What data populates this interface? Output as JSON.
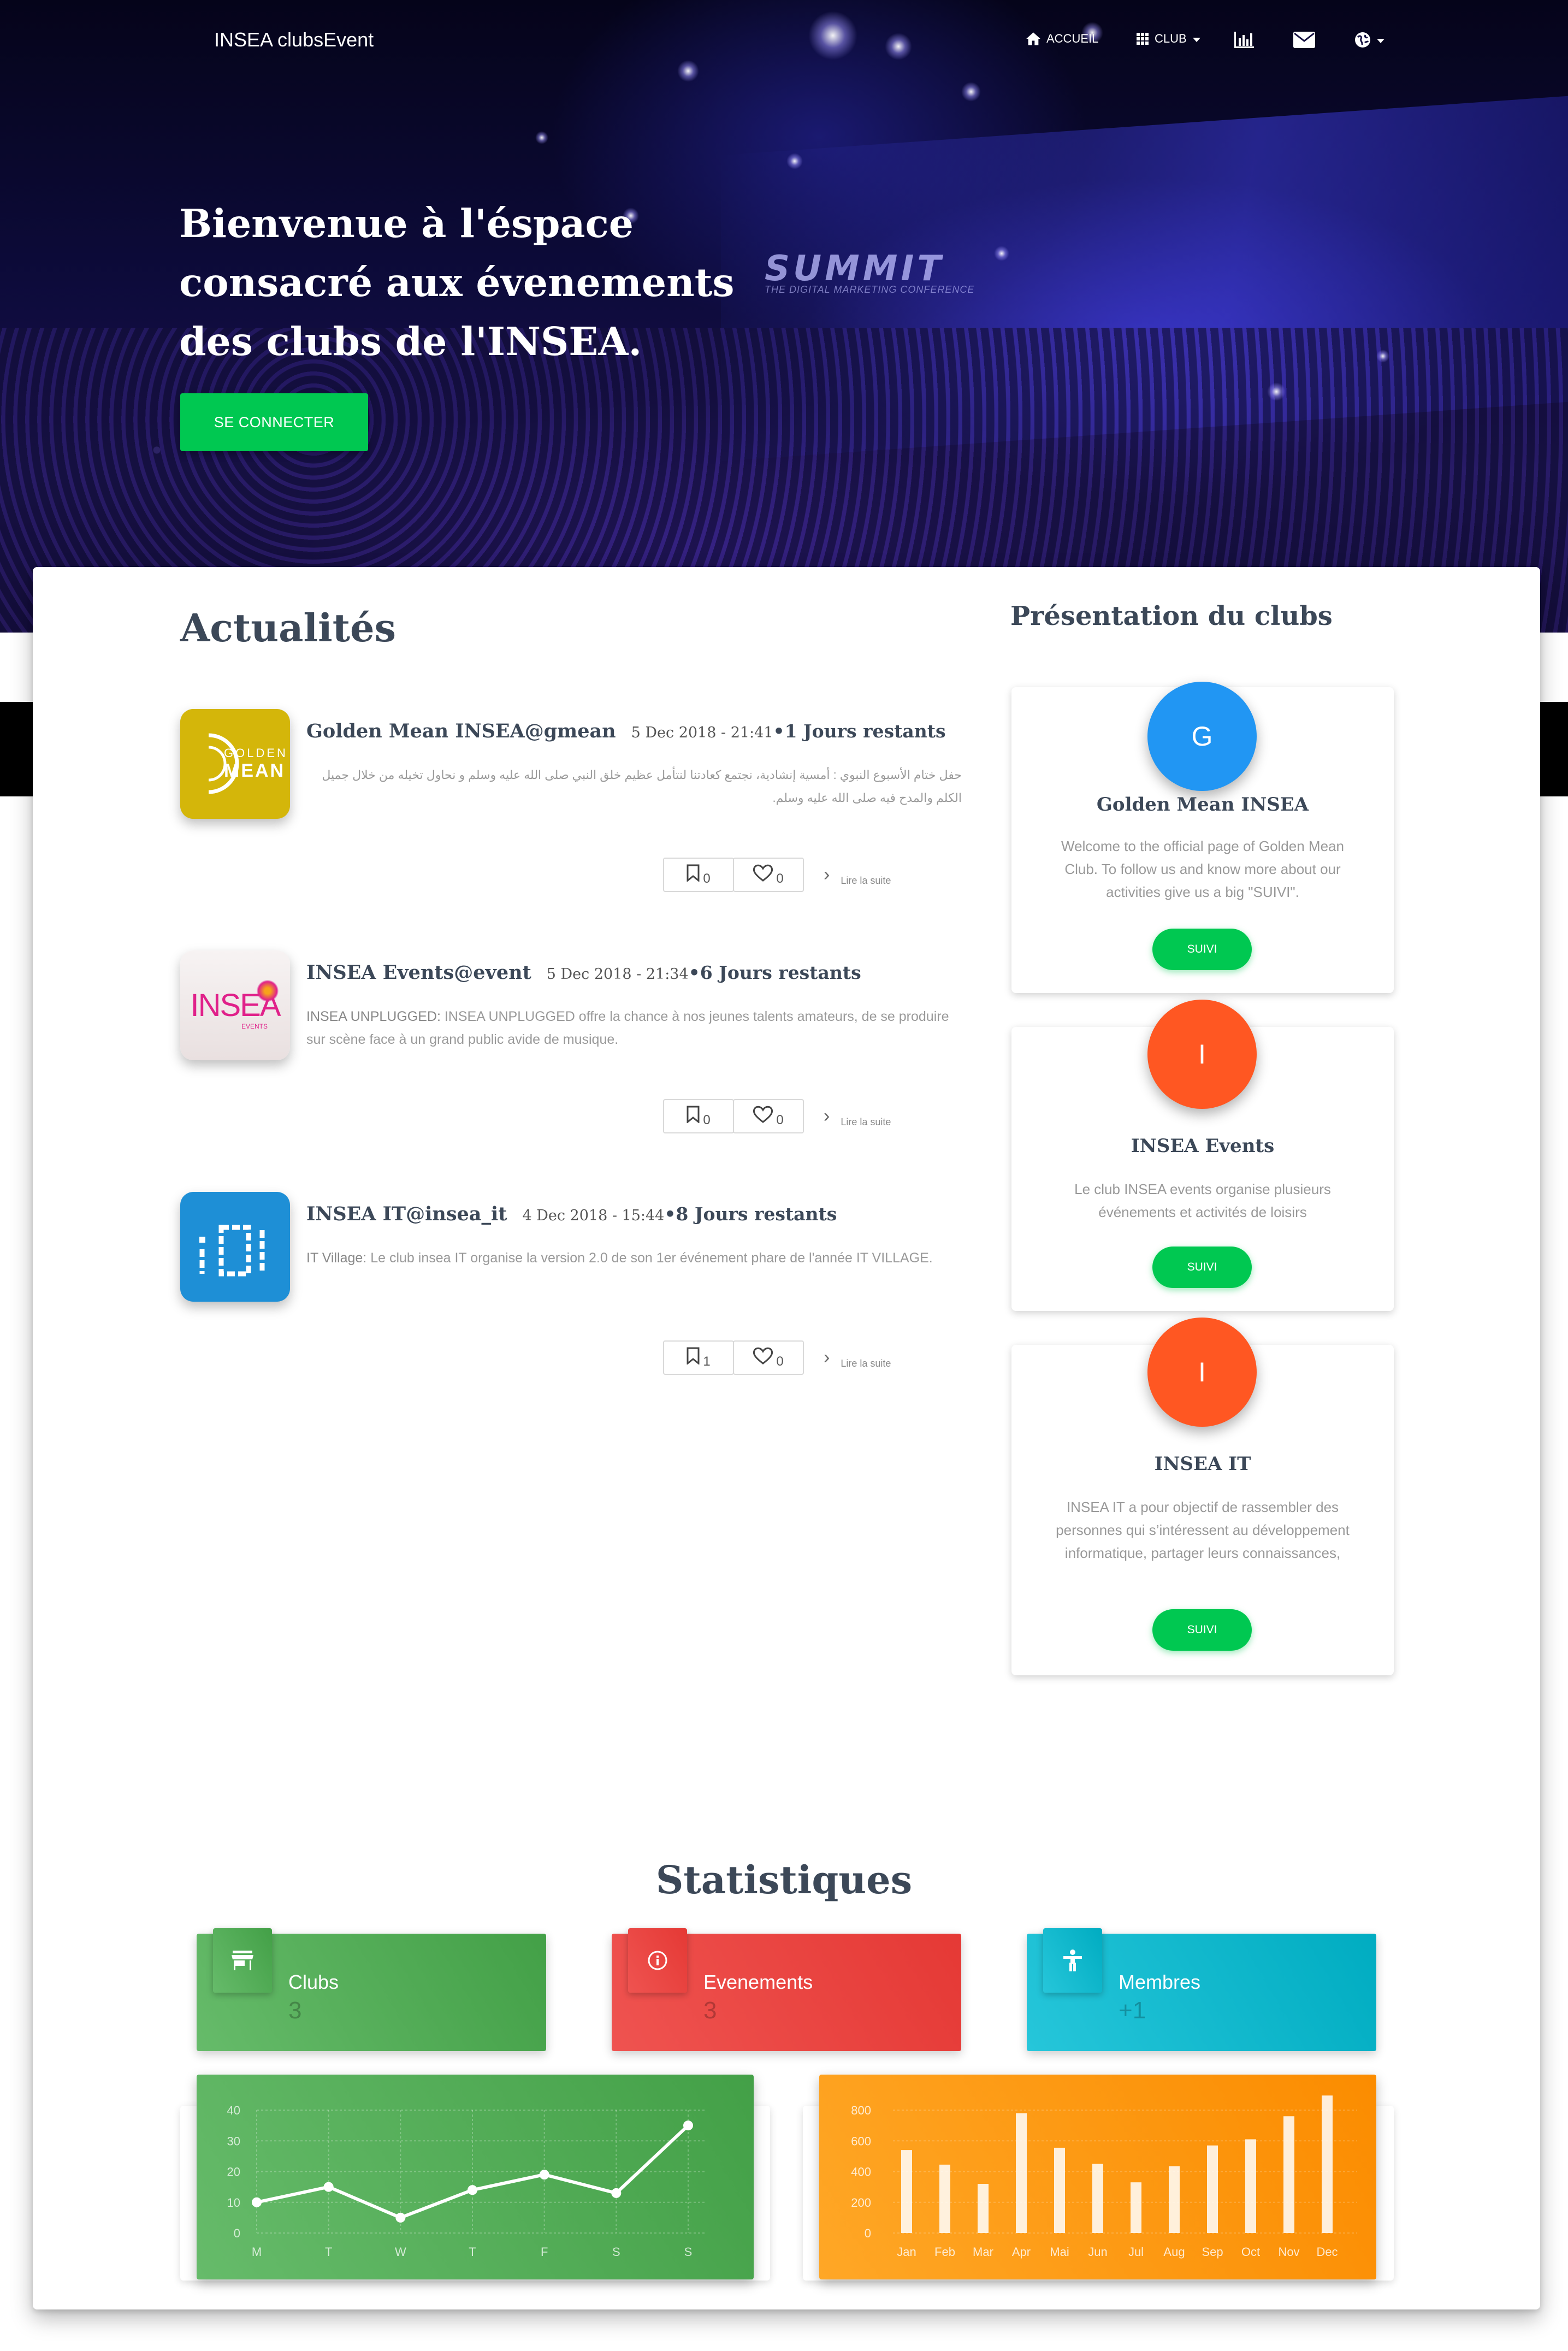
{
  "nav": {
    "brand": "INSEA clubsEvent",
    "items": [
      {
        "label": "ACCUEIL",
        "icon": "home-icon"
      },
      {
        "label": "CLUB",
        "icon": "grid-icon"
      },
      {
        "label": "",
        "icon": "bar-chart-icon"
      },
      {
        "label": "",
        "icon": "envelope-icon"
      },
      {
        "label": "",
        "icon": "globe-icon"
      }
    ]
  },
  "hero": {
    "title": "Bienvenue à l'éspace consacré aux évenements des clubs de l'INSEA.",
    "connect_label": "SE CONNECTER",
    "banner_text": "SUMMIT",
    "banner_sub": "THE DIGITAL MARKETING CONFERENCE"
  },
  "news": {
    "title": "Actualités",
    "read_more": "Lire la suite",
    "items": [
      {
        "club": "Golden Mean INSEA@gmean",
        "date": "5 Dec 2018 - 21:41",
        "remaining": "•1 Jours restants",
        "description": "حفل ختام الأسبوع النبوي : أمسية إنشادية، نجتمع كعادتنا لنتأمل عظيم خلق النبي صلى الله عليه وسلم و نحاول تخيله من خلال جميل الكلم والمدح فيه صلى الله عليه وسلم.",
        "saves": "0",
        "likes": "0",
        "logo_text_top": "GOLDEN",
        "logo_text_bottom": "MEAN",
        "logo_color": "#d4b60a"
      },
      {
        "club": "INSEA Events@event",
        "date": "5 Dec 2018 - 21:34",
        "remaining": "•6 Jours restants",
        "description_label": "INSEA UNPLUGGED:",
        "description": "INSEA UNPLUGGED offre la chance à nos jeunes talents amateurs, de se produire sur scène face à un grand public avide de musique.",
        "saves": "0",
        "likes": "0",
        "logo_text_top": "INSEA",
        "logo_text_bottom": "EVENTS",
        "logo_color": "#f2ecec"
      },
      {
        "club": "INSEA IT@insea_it",
        "date": "4 Dec 2018 - 15:44",
        "remaining": "•8 Jours restants",
        "description_label": "IT Village:",
        "description": "Le club insea IT organise la version 2.0 de son 1er événement phare de l'année IT VILLAGE.",
        "saves": "1",
        "likes": "0",
        "logo_text_top": "IT",
        "logo_text_bottom": "",
        "logo_color": "#1e8fd6"
      }
    ]
  },
  "clubs": {
    "title": "Présentation du clubs",
    "follow_label": "SUIVI",
    "items": [
      {
        "initial": "G",
        "name": "Golden Mean INSEA",
        "description": "Welcome to the official page of Golden Mean Club. To follow us and know more about our activities give us a big \"SUIVI\".",
        "avatar_color": "#2196f3"
      },
      {
        "initial": "I",
        "name": "INSEA Events",
        "description": "Le club INSEA events organise plusieurs événements et activités de loisirs",
        "avatar_color": "#ff5722"
      },
      {
        "initial": "I",
        "name": "INSEA IT",
        "description": "INSEA IT a pour objectif de rassembler des personnes qui s’intéressent au développement informatique, partager leurs connaissances,",
        "avatar_color": "#ff5722"
      }
    ]
  },
  "stats": {
    "title": "Statistiques",
    "cards": [
      {
        "label": "Clubs",
        "value": "3",
        "icon": "store-icon",
        "color": "#4caf50"
      },
      {
        "label": "Evenements",
        "value": "3",
        "icon": "info-icon",
        "color": "#e53935"
      },
      {
        "label": "Membres",
        "value": "+1",
        "icon": "accessibility-icon",
        "color": "#00bcd4"
      }
    ]
  },
  "chart_data": [
    {
      "type": "line",
      "categories": [
        "M",
        "T",
        "W",
        "T",
        "F",
        "S",
        "S"
      ],
      "values": [
        10,
        15,
        5,
        14,
        19,
        13,
        35
      ],
      "yticks": [
        "0",
        "10",
        "20",
        "30",
        "40"
      ],
      "ylim": [
        0,
        40
      ],
      "grid": true,
      "color": "#4caf50"
    },
    {
      "type": "bar",
      "categories": [
        "Jan",
        "Feb",
        "Mar",
        "Apr",
        "Mai",
        "Jun",
        "Jul",
        "Aug",
        "Sep",
        "Oct",
        "Nov",
        "Dec"
      ],
      "values": [
        540,
        445,
        320,
        780,
        555,
        450,
        330,
        435,
        570,
        610,
        760,
        895
      ],
      "yticks": [
        "0",
        "200",
        "400",
        "600",
        "800"
      ],
      "ylim": [
        0,
        800
      ],
      "grid": true,
      "color": "#ff9800"
    }
  ]
}
